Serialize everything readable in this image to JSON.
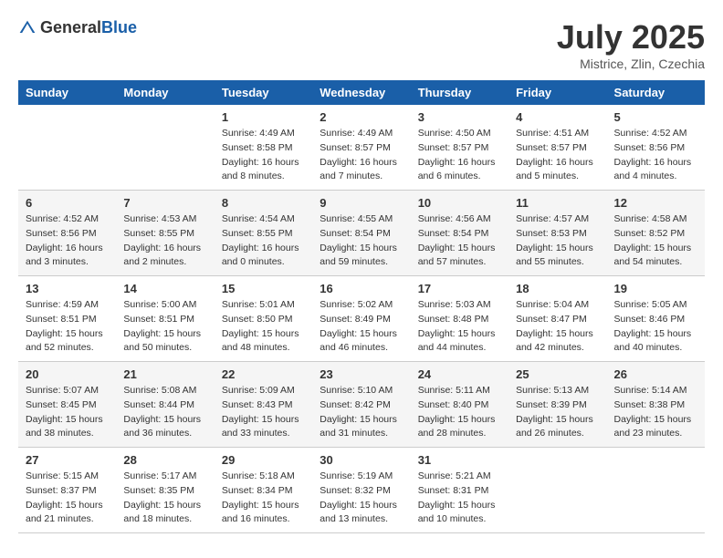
{
  "header": {
    "logo_general": "General",
    "logo_blue": "Blue",
    "month_title": "July 2025",
    "location": "Mistrice, Zlin, Czechia"
  },
  "weekdays": [
    "Sunday",
    "Monday",
    "Tuesday",
    "Wednesday",
    "Thursday",
    "Friday",
    "Saturday"
  ],
  "weeks": [
    [
      {
        "day": "",
        "info": ""
      },
      {
        "day": "",
        "info": ""
      },
      {
        "day": "1",
        "info": "Sunrise: 4:49 AM\nSunset: 8:58 PM\nDaylight: 16 hours and 8 minutes."
      },
      {
        "day": "2",
        "info": "Sunrise: 4:49 AM\nSunset: 8:57 PM\nDaylight: 16 hours and 7 minutes."
      },
      {
        "day": "3",
        "info": "Sunrise: 4:50 AM\nSunset: 8:57 PM\nDaylight: 16 hours and 6 minutes."
      },
      {
        "day": "4",
        "info": "Sunrise: 4:51 AM\nSunset: 8:57 PM\nDaylight: 16 hours and 5 minutes."
      },
      {
        "day": "5",
        "info": "Sunrise: 4:52 AM\nSunset: 8:56 PM\nDaylight: 16 hours and 4 minutes."
      }
    ],
    [
      {
        "day": "6",
        "info": "Sunrise: 4:52 AM\nSunset: 8:56 PM\nDaylight: 16 hours and 3 minutes."
      },
      {
        "day": "7",
        "info": "Sunrise: 4:53 AM\nSunset: 8:55 PM\nDaylight: 16 hours and 2 minutes."
      },
      {
        "day": "8",
        "info": "Sunrise: 4:54 AM\nSunset: 8:55 PM\nDaylight: 16 hours and 0 minutes."
      },
      {
        "day": "9",
        "info": "Sunrise: 4:55 AM\nSunset: 8:54 PM\nDaylight: 15 hours and 59 minutes."
      },
      {
        "day": "10",
        "info": "Sunrise: 4:56 AM\nSunset: 8:54 PM\nDaylight: 15 hours and 57 minutes."
      },
      {
        "day": "11",
        "info": "Sunrise: 4:57 AM\nSunset: 8:53 PM\nDaylight: 15 hours and 55 minutes."
      },
      {
        "day": "12",
        "info": "Sunrise: 4:58 AM\nSunset: 8:52 PM\nDaylight: 15 hours and 54 minutes."
      }
    ],
    [
      {
        "day": "13",
        "info": "Sunrise: 4:59 AM\nSunset: 8:51 PM\nDaylight: 15 hours and 52 minutes."
      },
      {
        "day": "14",
        "info": "Sunrise: 5:00 AM\nSunset: 8:51 PM\nDaylight: 15 hours and 50 minutes."
      },
      {
        "day": "15",
        "info": "Sunrise: 5:01 AM\nSunset: 8:50 PM\nDaylight: 15 hours and 48 minutes."
      },
      {
        "day": "16",
        "info": "Sunrise: 5:02 AM\nSunset: 8:49 PM\nDaylight: 15 hours and 46 minutes."
      },
      {
        "day": "17",
        "info": "Sunrise: 5:03 AM\nSunset: 8:48 PM\nDaylight: 15 hours and 44 minutes."
      },
      {
        "day": "18",
        "info": "Sunrise: 5:04 AM\nSunset: 8:47 PM\nDaylight: 15 hours and 42 minutes."
      },
      {
        "day": "19",
        "info": "Sunrise: 5:05 AM\nSunset: 8:46 PM\nDaylight: 15 hours and 40 minutes."
      }
    ],
    [
      {
        "day": "20",
        "info": "Sunrise: 5:07 AM\nSunset: 8:45 PM\nDaylight: 15 hours and 38 minutes."
      },
      {
        "day": "21",
        "info": "Sunrise: 5:08 AM\nSunset: 8:44 PM\nDaylight: 15 hours and 36 minutes."
      },
      {
        "day": "22",
        "info": "Sunrise: 5:09 AM\nSunset: 8:43 PM\nDaylight: 15 hours and 33 minutes."
      },
      {
        "day": "23",
        "info": "Sunrise: 5:10 AM\nSunset: 8:42 PM\nDaylight: 15 hours and 31 minutes."
      },
      {
        "day": "24",
        "info": "Sunrise: 5:11 AM\nSunset: 8:40 PM\nDaylight: 15 hours and 28 minutes."
      },
      {
        "day": "25",
        "info": "Sunrise: 5:13 AM\nSunset: 8:39 PM\nDaylight: 15 hours and 26 minutes."
      },
      {
        "day": "26",
        "info": "Sunrise: 5:14 AM\nSunset: 8:38 PM\nDaylight: 15 hours and 23 minutes."
      }
    ],
    [
      {
        "day": "27",
        "info": "Sunrise: 5:15 AM\nSunset: 8:37 PM\nDaylight: 15 hours and 21 minutes."
      },
      {
        "day": "28",
        "info": "Sunrise: 5:17 AM\nSunset: 8:35 PM\nDaylight: 15 hours and 18 minutes."
      },
      {
        "day": "29",
        "info": "Sunrise: 5:18 AM\nSunset: 8:34 PM\nDaylight: 15 hours and 16 minutes."
      },
      {
        "day": "30",
        "info": "Sunrise: 5:19 AM\nSunset: 8:32 PM\nDaylight: 15 hours and 13 minutes."
      },
      {
        "day": "31",
        "info": "Sunrise: 5:21 AM\nSunset: 8:31 PM\nDaylight: 15 hours and 10 minutes."
      },
      {
        "day": "",
        "info": ""
      },
      {
        "day": "",
        "info": ""
      }
    ]
  ]
}
